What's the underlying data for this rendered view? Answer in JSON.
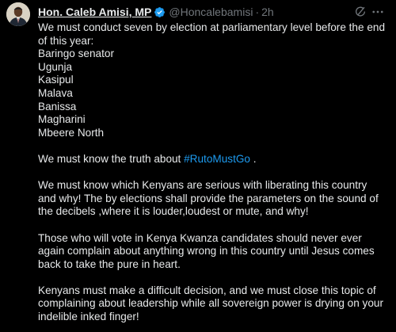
{
  "author": {
    "name": "Hon. Caleb Amisi, MP",
    "handle": "@Honcalebamisi",
    "separator": "·",
    "time": "2h"
  },
  "icons": {
    "verified": "verified-badge-icon",
    "grok": "grok-icon",
    "more": "more-horizontal-icon"
  },
  "colors": {
    "background": "#000000",
    "text": "#e7e9ea",
    "secondary": "#71767b",
    "link": "#1d9bf0",
    "verified": "#1d9bf0"
  },
  "tweet": {
    "intro": "We must conduct seven by election at parliamentary level before the end of this year:",
    "places": [
      "Baringo senator",
      "Ugunja",
      "Kasipul",
      "Malava",
      "Banissa",
      "Magharini",
      "Mbeere North"
    ],
    "truth_prefix": "We must know the truth about ",
    "hashtag": "#RutoMustGo",
    "truth_suffix": " .",
    "para2": "We must know which Kenyans are serious with liberating this country and why! The by elections shall provide the parameters on the sound of the decibels ,where it is louder,loudest or mute, and why!",
    "para3": "Those who will vote in Kenya Kwanza candidates should never ever again complain about anything wrong in this country until Jesus comes back to take the pure in heart.",
    "para4": "Kenyans must make a difficult decision, and we must close this topic of complaining about leadership while all sovereign power is drying on your indelible inked finger!"
  }
}
